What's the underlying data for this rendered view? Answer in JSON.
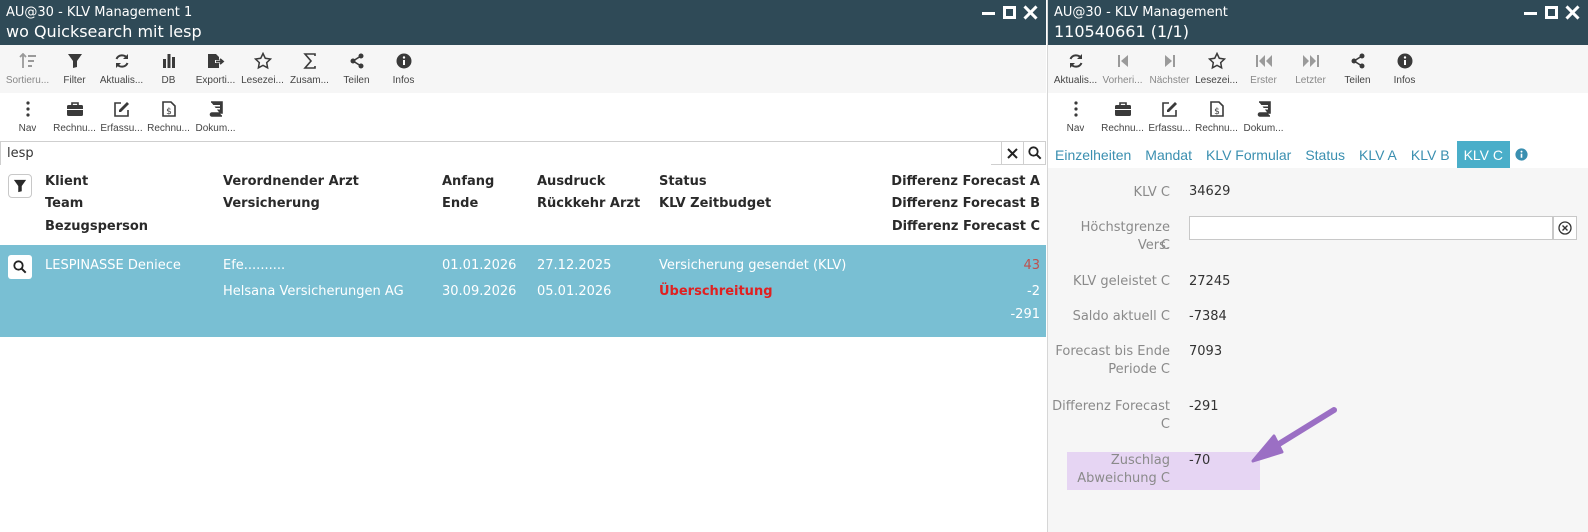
{
  "left": {
    "title": "AU@30 - KLV Management 1",
    "subtitle": "wo Quicksearch mit lesp",
    "toolbar1": [
      {
        "label": "Sortieru...",
        "icon": "sort-icon",
        "disabled": true
      },
      {
        "label": "Filter",
        "icon": "filter-icon"
      },
      {
        "label": "Aktualis...",
        "icon": "refresh-icon"
      },
      {
        "label": "DB",
        "icon": "bar-chart-icon"
      },
      {
        "label": "Exporti...",
        "icon": "export-icon"
      },
      {
        "label": "Lesezei...",
        "icon": "star-icon"
      },
      {
        "label": "Zusam...",
        "icon": "sigma-icon"
      },
      {
        "label": "Teilen",
        "icon": "share-icon"
      },
      {
        "label": "Infos",
        "icon": "info-icon"
      }
    ],
    "toolbar2": [
      {
        "label": "Nav",
        "icon": "vertical-dots-icon"
      },
      {
        "label": "Rechnu...",
        "icon": "briefcase-icon"
      },
      {
        "label": "Erfassu...",
        "icon": "edit-icon"
      },
      {
        "label": "Rechnu...",
        "icon": "invoice-icon"
      },
      {
        "label": "Dokum...",
        "icon": "book-icon"
      }
    ],
    "search": {
      "value": "lesp"
    },
    "columns": {
      "col1": [
        "Klient",
        "Team",
        "Bezugsperson"
      ],
      "col2": [
        "Verordnender Arzt",
        "Versicherung"
      ],
      "col3": [
        "Anfang",
        "Ende"
      ],
      "col4": [
        "Ausdruck",
        "Rückkehr Arzt"
      ],
      "col5": [
        "Status",
        "KLV Zeitbudget"
      ],
      "col6": [
        "Differenz Forecast A",
        "Differenz Forecast B",
        "Differenz Forecast C"
      ]
    },
    "row": {
      "client": "LESPINASSE Deniece",
      "doctor": "Efe..........",
      "insurance": "Helsana Versicherungen AG",
      "start": "01.01.2026",
      "end": "30.09.2026",
      "print": "27.12.2025",
      "return": "05.01.2026",
      "status": "Versicherung gesendet (KLV)",
      "budget": "Überschreitung",
      "diffA": "43",
      "diffB": "-2",
      "diffC": "-291"
    }
  },
  "right": {
    "title": "AU@30 - KLV Management",
    "subtitle": "110540661 (1/1)",
    "toolbar1": [
      {
        "label": "Aktualis...",
        "icon": "refresh-icon"
      },
      {
        "label": "Vorheri...",
        "icon": "previous-icon",
        "disabled": true
      },
      {
        "label": "Nächster",
        "icon": "next-icon",
        "disabled": true
      },
      {
        "label": "Lesezei...",
        "icon": "star-icon"
      },
      {
        "label": "Erster",
        "icon": "first-icon",
        "disabled": true
      },
      {
        "label": "Letzter",
        "icon": "last-icon",
        "disabled": true
      },
      {
        "label": "Teilen",
        "icon": "share-icon"
      },
      {
        "label": "Infos",
        "icon": "info-icon"
      }
    ],
    "toolbar2": [
      {
        "label": "Nav",
        "icon": "vertical-dots-icon"
      },
      {
        "label": "Rechnu...",
        "icon": "briefcase-icon"
      },
      {
        "label": "Erfassu...",
        "icon": "edit-icon"
      },
      {
        "label": "Rechnu...",
        "icon": "invoice-icon"
      },
      {
        "label": "Dokum...",
        "icon": "book-icon"
      }
    ],
    "tabs": [
      "Einzelheiten",
      "Mandat",
      "KLV Formular",
      "Status",
      "KLV A",
      "KLV B",
      "KLV C"
    ],
    "active_tab": "KLV C",
    "fields": {
      "klv_c": {
        "label": "KLV C",
        "value": "34629"
      },
      "hoechst": {
        "label1": "Höchstgrenze Vers.",
        "label2": "C",
        "value": ""
      },
      "geleistet": {
        "label": "KLV geleistet C",
        "value": "27245"
      },
      "saldo": {
        "label": "Saldo aktuell C",
        "value": "-7384"
      },
      "forecast": {
        "label1": "Forecast bis Ende",
        "label2": "Periode C",
        "value": "7093"
      },
      "differenz": {
        "label1": "Differenz Forecast",
        "label2": "C",
        "value": "-291"
      },
      "zuschlag": {
        "label1": "Zuschlag",
        "label2": "Abweichung C",
        "value": "-70"
      }
    }
  },
  "colors": {
    "titlebar": "#2f4a57",
    "row_highlight": "#79bfd3",
    "tab_active": "#4aaec9",
    "tab_text": "#3a8fb0",
    "over_budget": "#e02020",
    "positive_diff": "#c0504d",
    "annotation": "#9b6fc4",
    "annotation_bg": "#e6d5f3"
  }
}
